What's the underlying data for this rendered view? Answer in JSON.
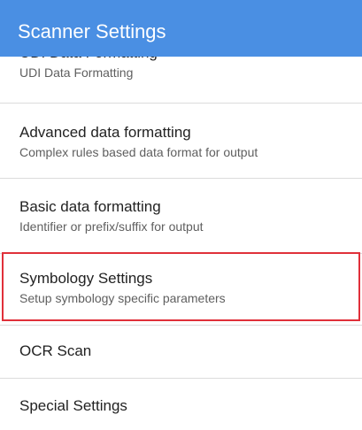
{
  "app_bar": {
    "title": "Scanner Settings",
    "color": "#4a8fe3"
  },
  "items": [
    {
      "title": "UDI Data Formatting",
      "subtitle": "UDI Data Formatting"
    },
    {
      "title": "Advanced data formatting",
      "subtitle": "Complex rules based data format for output"
    },
    {
      "title": "Basic data formatting",
      "subtitle": "Identifier or prefix/suffix for output"
    },
    {
      "title": "Symbology Settings",
      "subtitle": "Setup symbology specific parameters",
      "highlighted": true
    },
    {
      "title": "OCR Scan"
    },
    {
      "title": "Special Settings"
    }
  ],
  "highlight_color": "#e0303a"
}
